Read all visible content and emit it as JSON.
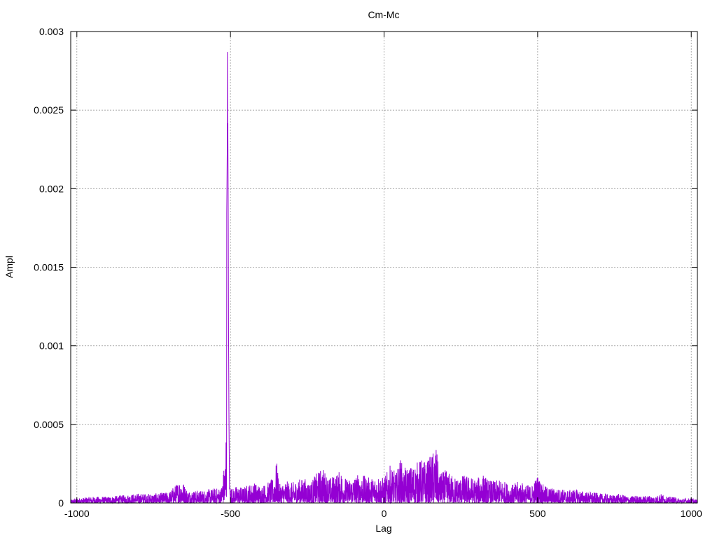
{
  "chart_data": {
    "type": "line",
    "title": "Cm-Mc",
    "xlabel": "Lag",
    "ylabel": "Ampl",
    "xlim": [
      -1020,
      1020
    ],
    "ylim": [
      0,
      0.003
    ],
    "x_ticks": [
      -1000,
      -500,
      0,
      500,
      1000
    ],
    "x_tick_labels": [
      "-1000",
      "-500",
      "0",
      "500",
      "1000"
    ],
    "y_ticks": [
      0,
      0.0005,
      0.001,
      0.0015,
      0.002,
      0.0025,
      0.003
    ],
    "y_tick_labels": [
      "0",
      "0.0005",
      "0.001",
      "0.0015",
      "0.002",
      "0.0025",
      "0.003"
    ],
    "grid": true,
    "legend": false,
    "series": [
      {
        "color": "#9400d3",
        "x": [
          -1020,
          -1000,
          -950,
          -900,
          -850,
          -800,
          -750,
          -700,
          -660,
          -640,
          -600,
          -560,
          -530,
          -515,
          -510,
          -508,
          -505,
          -503,
          -500,
          -495,
          -480,
          -460,
          -440,
          -420,
          -400,
          -380,
          -360,
          -350,
          -340,
          -320,
          -300,
          -280,
          -260,
          -240,
          -220,
          -200,
          -180,
          -160,
          -140,
          -120,
          -100,
          -80,
          -60,
          -40,
          -20,
          0,
          20,
          40,
          55,
          60,
          80,
          100,
          120,
          140,
          170,
          180,
          200,
          220,
          240,
          260,
          280,
          300,
          320,
          340,
          360,
          380,
          400,
          420,
          440,
          460,
          480,
          500,
          520,
          540,
          560,
          580,
          600,
          620,
          640,
          660,
          680,
          700,
          720,
          740,
          760,
          780,
          800,
          820,
          840,
          860,
          880,
          900,
          920,
          940,
          960,
          980,
          1000,
          1020
        ],
        "y": [
          2e-05,
          3e-05,
          4e-05,
          4e-05,
          5e-05,
          6e-05,
          6e-05,
          7e-05,
          0.00016,
          8e-05,
          8e-05,
          9e-05,
          0.0001,
          0.00032,
          0.0029,
          0.00233,
          0.0006,
          0.0001,
          0.00012,
          9e-05,
          0.00011,
          0.0001,
          0.00012,
          0.00013,
          0.00011,
          0.00013,
          0.00016,
          0.00027,
          0.00012,
          0.00014,
          0.00013,
          0.00015,
          0.00016,
          0.00013,
          0.00019,
          0.00023,
          0.00016,
          0.00018,
          0.00021,
          0.00015,
          0.00017,
          0.00019,
          0.00017,
          0.00016,
          0.00018,
          0.00016,
          0.00024,
          0.00019,
          0.0003,
          0.00022,
          0.00023,
          0.00025,
          0.00028,
          0.00027,
          0.00036,
          0.00019,
          0.00021,
          0.00018,
          0.00016,
          0.00018,
          0.00017,
          0.00015,
          0.00019,
          0.00015,
          0.00014,
          0.00015,
          0.00013,
          0.00012,
          0.00014,
          0.00012,
          0.00011,
          0.00018,
          0.00011,
          0.0001,
          9e-05,
          9e-05,
          8e-05,
          9e-05,
          8e-05,
          7e-05,
          7e-05,
          6e-05,
          6e-05,
          5e-05,
          6e-05,
          5e-05,
          4e-05,
          5e-05,
          4e-05,
          5e-05,
          4e-05,
          6e-05,
          4e-05,
          4e-05,
          3e-05,
          3e-05,
          3e-05,
          2e-05
        ]
      }
    ]
  }
}
